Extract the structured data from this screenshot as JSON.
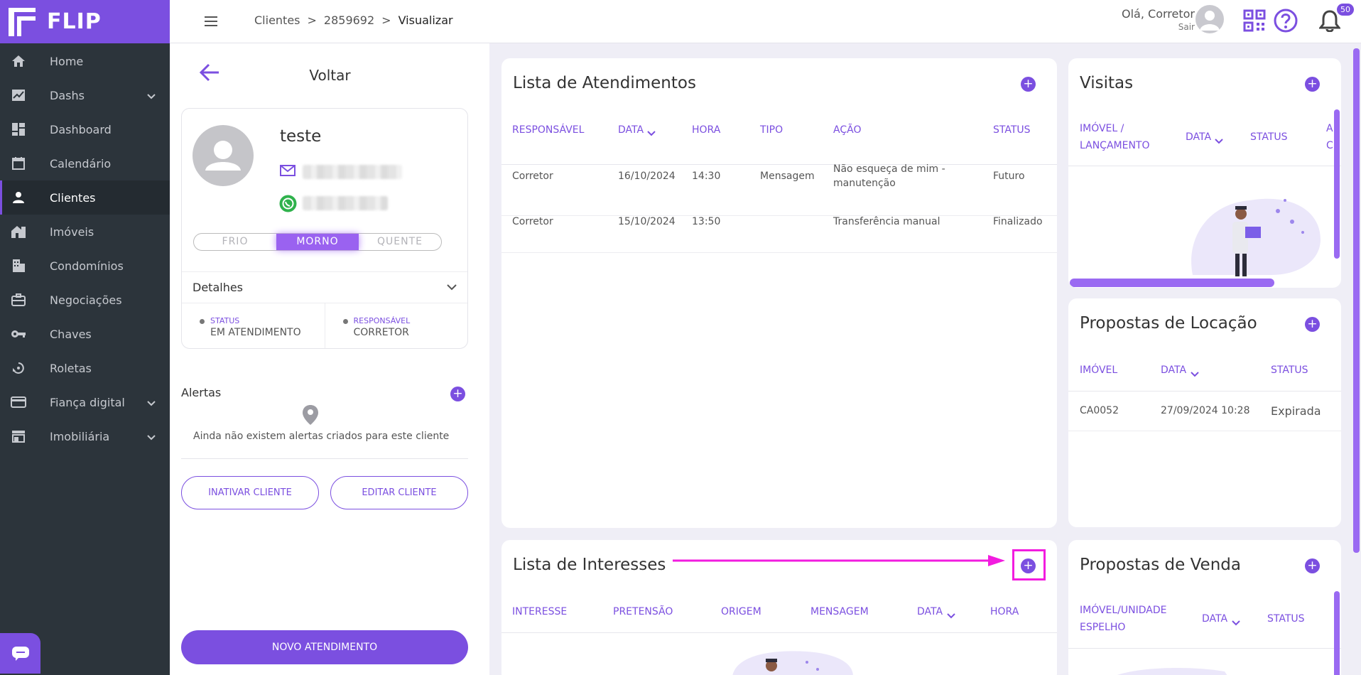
{
  "app": {
    "brand": "FLIP"
  },
  "sidebar": {
    "items": [
      {
        "label": "Home",
        "icon": "home-icon"
      },
      {
        "label": "Dashs",
        "icon": "chart-icon",
        "caret": true
      },
      {
        "label": "Dashboard",
        "icon": "dashboard-icon"
      },
      {
        "label": "Calendário",
        "icon": "calendar-icon"
      },
      {
        "label": "Clientes",
        "icon": "person-icon",
        "active": true
      },
      {
        "label": "Imóveis",
        "icon": "building-icon"
      },
      {
        "label": "Condomínios",
        "icon": "condo-icon"
      },
      {
        "label": "Negociações",
        "icon": "briefcase-icon"
      },
      {
        "label": "Chaves",
        "icon": "key-icon"
      },
      {
        "label": "Roletas",
        "icon": "roulette-icon"
      },
      {
        "label": "Fiança digital",
        "icon": "card-icon",
        "caret": true
      },
      {
        "label": "Imobiliária",
        "icon": "store-icon",
        "caret": true
      }
    ]
  },
  "topbar": {
    "breadcrumb": [
      "Clientes",
      "2859692",
      "Visualizar"
    ],
    "separator": ">",
    "greeting": "Olá, Corretor",
    "logout": "Sair",
    "notifications": "50"
  },
  "client": {
    "back_label": "Voltar",
    "name": "teste",
    "temperature": {
      "options": [
        "FRIO",
        "MORNO",
        "QUENTE"
      ],
      "selected": "MORNO"
    },
    "details_label": "Detalhes",
    "status_label": "STATUS",
    "status_value": "EM ATENDIMENTO",
    "responsavel_label": "RESPONSÁVEL",
    "responsavel_value": "CORRETOR",
    "alerts_title": "Alertas",
    "alerts_empty": "Ainda não existem alertas criados para este cliente",
    "inactivate_label": "INATIVAR CLIENTE",
    "edit_label": "EDITAR CLIENTE",
    "new_service_label": "NOVO ATENDIMENTO"
  },
  "atendimentos": {
    "title": "Lista de Atendimentos",
    "headers": [
      "RESPONSÁVEL",
      "DATA",
      "HORA",
      "TIPO",
      "AÇÃO",
      "STATUS"
    ],
    "rows": [
      {
        "responsavel": "Corretor",
        "data": "16/10/2024",
        "hora": "14:30",
        "tipo": "Mensagem",
        "acao_1": "Não esqueça de mim -",
        "acao_2": "manutenção",
        "status": "Futuro"
      },
      {
        "responsavel": "Corretor",
        "data": "15/10/2024",
        "hora": "13:50",
        "tipo": "",
        "acao_1": "Transferência manual",
        "acao_2": "",
        "status": "Finalizado"
      }
    ]
  },
  "visitas": {
    "title": "Visitas",
    "headers": [
      "IMÓVEL /",
      "LANÇAMENTO",
      "DATA",
      "STATUS",
      "A",
      "C"
    ]
  },
  "locacao": {
    "title": "Propostas de Locação",
    "headers": [
      "IMÓVEL",
      "DATA",
      "STATUS"
    ],
    "rows": [
      {
        "imovel": "CA0052",
        "data": "27/09/2024 10:28",
        "status": "Expirada"
      }
    ]
  },
  "interesses": {
    "title": "Lista de Interesses",
    "headers": [
      "INTERESSE",
      "PRETENSÃO",
      "ORIGEM",
      "MENSAGEM",
      "DATA",
      "HORA"
    ]
  },
  "venda": {
    "title": "Propostas de Venda",
    "headers": [
      "IMÓVEL/UNIDADE",
      "ESPELHO",
      "DATA",
      "STATUS"
    ]
  },
  "colors": {
    "accent": "#7b4fe0",
    "sidebar": "#2c343b",
    "annotation": "#f21cdf"
  }
}
